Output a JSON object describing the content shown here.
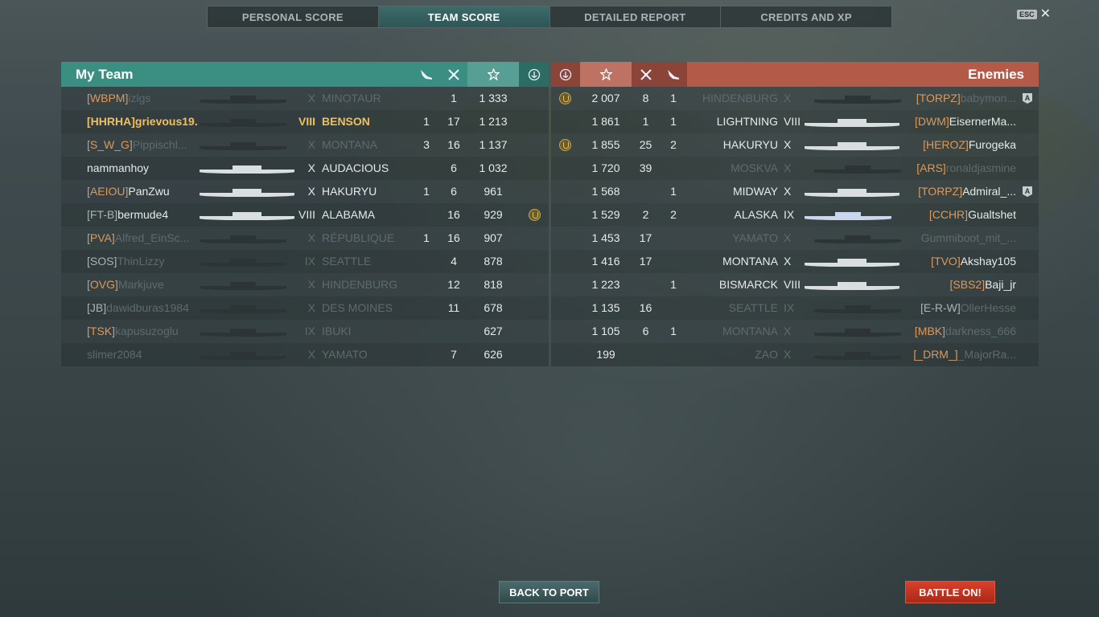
{
  "tabs": [
    "PERSONAL SCORE",
    "TEAM SCORE",
    "DETAILED REPORT",
    "CREDITS AND XP"
  ],
  "active_tab": 1,
  "esc_label": "ESC",
  "close_glyph": "✕",
  "my_team": {
    "title": "My Team",
    "columns_icons": [
      "plane-icon",
      "kill-icon",
      "star-icon",
      "medal-icon"
    ],
    "rows": [
      {
        "clan": "[WBPM]",
        "name": "izlgs",
        "tier": "X",
        "ship": "MINOTAUR",
        "planes": "",
        "kills": "1",
        "score": "1 333",
        "medal": false,
        "style": "dim",
        "ship_style": "dark"
      },
      {
        "clan": "[HHRHA]",
        "name": "grievous19...",
        "tier": "VIII",
        "ship": "BENSON",
        "planes": "1",
        "kills": "17",
        "score": "1 213",
        "medal": false,
        "style": "self",
        "ship_style": "dark"
      },
      {
        "clan": "[S_W_G]",
        "name": "Pippischl...",
        "tier": "X",
        "ship": "MONTANA",
        "planes": "3",
        "kills": "16",
        "score": "1 137",
        "medal": false,
        "style": "dim",
        "ship_style": "dark"
      },
      {
        "clan": "",
        "name": "nammanhoy",
        "tier": "X",
        "ship": "AUDACIOUS",
        "planes": "",
        "kills": "6",
        "score": "1 032",
        "medal": false,
        "style": "normal",
        "ship_style": "light"
      },
      {
        "clan": "[AEIOU]",
        "name": "PanZwu",
        "tier": "X",
        "ship": "HAKURYU",
        "planes": "1",
        "kills": "6",
        "score": "961",
        "medal": false,
        "style": "normal",
        "ship_style": "light"
      },
      {
        "clan": "[FT-B]",
        "name": "bermude4",
        "tier": "VIII",
        "ship": "ALABAMA",
        "planes": "",
        "kills": "16",
        "score": "929",
        "medal": true,
        "style": "normal",
        "ship_style": "light"
      },
      {
        "clan": "[PVA]",
        "name": "Alfred_EinSc...",
        "tier": "X",
        "ship": "RÉPUBLIQUE",
        "planes": "1",
        "kills": "16",
        "score": "907",
        "medal": false,
        "style": "dim",
        "ship_style": "dark"
      },
      {
        "clan": "[SOS]",
        "name": "ThinLizzy",
        "tier": "IX",
        "ship": "SEATTLE",
        "planes": "",
        "kills": "4",
        "score": "878",
        "medal": false,
        "style": "dim",
        "ship_style": "dark"
      },
      {
        "clan": "[OVG]",
        "name": "Markjuve",
        "tier": "X",
        "ship": "HINDENBURG",
        "planes": "",
        "kills": "12",
        "score": "818",
        "medal": false,
        "style": "dim",
        "ship_style": "dark"
      },
      {
        "clan": "[JB]",
        "name": "dawidburas1984",
        "tier": "X",
        "ship": "DES MOINES",
        "planes": "",
        "kills": "11",
        "score": "678",
        "medal": false,
        "style": "dim",
        "ship_style": "dark"
      },
      {
        "clan": "[TSK]",
        "name": "kapusuzoglu",
        "tier": "IX",
        "ship": "IBUKI",
        "planes": "",
        "kills": "",
        "score": "627",
        "medal": false,
        "style": "dim",
        "ship_style": "dark"
      },
      {
        "clan": "",
        "name": "slimer2084",
        "tier": "X",
        "ship": "YAMATO",
        "planes": "",
        "kills": "7",
        "score": "626",
        "medal": false,
        "style": "dim",
        "ship_style": "dark"
      }
    ]
  },
  "enemies": {
    "title": "Enemies",
    "columns_icons": [
      "medal-icon",
      "star-icon",
      "kill-icon",
      "plane-icon"
    ],
    "rows": [
      {
        "medal": true,
        "score": "2 007",
        "kills": "8",
        "planes": "1",
        "ship": "HINDENBURG",
        "tier": "X",
        "clan": "[TORPZ]",
        "name": "babymon...",
        "badge": true,
        "style": "dim",
        "ship_style": "dark"
      },
      {
        "medal": false,
        "score": "1 861",
        "kills": "1",
        "planes": "1",
        "ship": "LIGHTNING",
        "tier": "VIII",
        "clan": "[DWM]",
        "name": "EisernerMa...",
        "badge": false,
        "style": "normal",
        "ship_style": "light"
      },
      {
        "medal": true,
        "score": "1 855",
        "kills": "25",
        "planes": "2",
        "ship": "HAKURYU",
        "tier": "X",
        "clan": "[HEROZ]",
        "name": "Furogeka",
        "badge": false,
        "style": "normal",
        "ship_style": "light"
      },
      {
        "medal": false,
        "score": "1 720",
        "kills": "39",
        "planes": "",
        "ship": "MOSKVA",
        "tier": "X",
        "clan": "[ARS]",
        "name": "ronaldjasmine",
        "badge": false,
        "style": "dim",
        "ship_style": "dark"
      },
      {
        "medal": false,
        "score": "1 568",
        "kills": "",
        "planes": "1",
        "ship": "MIDWAY",
        "tier": "X",
        "clan": "[TORPZ]",
        "name": "Admiral_...",
        "badge": true,
        "style": "normal",
        "ship_style": "light"
      },
      {
        "medal": false,
        "score": "1 529",
        "kills": "2",
        "planes": "2",
        "ship": "ALASKA",
        "tier": "IX",
        "clan": "[CCHR]",
        "name": "Gualtshet",
        "badge": false,
        "style": "normal",
        "ship_style": "lightblue"
      },
      {
        "medal": false,
        "score": "1 453",
        "kills": "17",
        "planes": "",
        "ship": "YAMATO",
        "tier": "X",
        "clan": "",
        "name": "Gummiboot_mit_...",
        "badge": false,
        "style": "dim",
        "ship_style": "dark"
      },
      {
        "medal": false,
        "score": "1 416",
        "kills": "17",
        "planes": "",
        "ship": "MONTANA",
        "tier": "X",
        "clan": "[TVO]",
        "name": "Akshay105",
        "badge": false,
        "style": "normal",
        "ship_style": "light"
      },
      {
        "medal": false,
        "score": "1 223",
        "kills": "",
        "planes": "1",
        "ship": "BISMARCK",
        "tier": "VIII",
        "clan": "[SBS2]",
        "name": "Baji_jr",
        "badge": false,
        "style": "normal",
        "ship_style": "light"
      },
      {
        "medal": false,
        "score": "1 135",
        "kills": "16",
        "planes": "",
        "ship": "SEATTLE",
        "tier": "IX",
        "clan": "[E-R-W]",
        "name": "OllerHesse",
        "badge": false,
        "style": "dim",
        "ship_style": "dark"
      },
      {
        "medal": false,
        "score": "1 105",
        "kills": "6",
        "planes": "1",
        "ship": "MONTANA",
        "tier": "X",
        "clan": "[MBK]",
        "name": "darkness_666",
        "badge": false,
        "style": "dim",
        "ship_style": "dark"
      },
      {
        "medal": false,
        "score": "199",
        "kills": "",
        "planes": "",
        "ship": "ZAO",
        "tier": "X",
        "clan": "[_DRM_]",
        "name": "_MajorRa...",
        "badge": false,
        "style": "dim",
        "ship_style": "dark"
      }
    ]
  },
  "buttons": {
    "back_to_port": "BACK TO PORT",
    "battle_on": "BATTLE ON!"
  },
  "colors": {
    "my_team_header": "#3a8f82",
    "enemy_header": "#b35a48",
    "self_highlight": "#f0c05a",
    "clan_tag": "#d99a5e",
    "battle_button": "#d9402a"
  }
}
